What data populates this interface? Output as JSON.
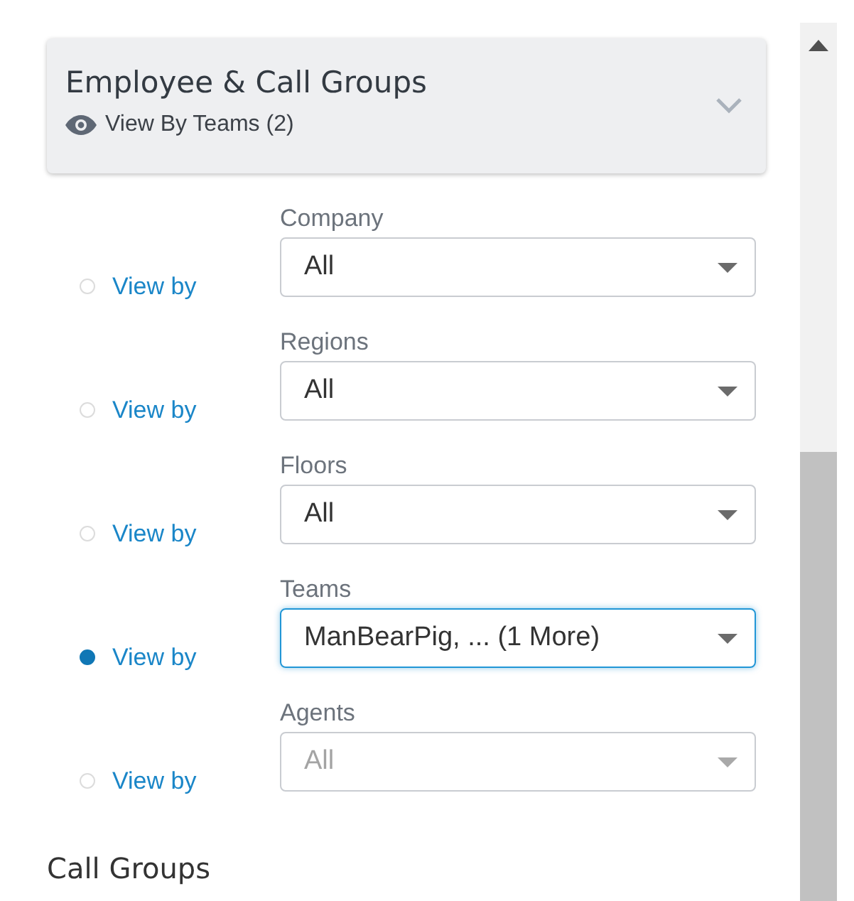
{
  "panel": {
    "title": "Employee & Call Groups",
    "subtitle": "View By Teams (2)",
    "expanded": false
  },
  "filters": [
    {
      "option": "View by",
      "selected": false,
      "label": "Company",
      "value": "All",
      "disabled": false
    },
    {
      "option": "View by",
      "selected": false,
      "label": "Regions",
      "value": "All",
      "disabled": false
    },
    {
      "option": "View by",
      "selected": false,
      "label": "Floors",
      "value": "All",
      "disabled": false
    },
    {
      "option": "View by",
      "selected": true,
      "label": "Teams",
      "value": "ManBearPig, ... (1 More)",
      "disabled": false
    },
    {
      "option": "View by",
      "selected": false,
      "label": "Agents",
      "value": "All",
      "disabled": true
    }
  ],
  "next_section": {
    "title": "Call Groups"
  }
}
